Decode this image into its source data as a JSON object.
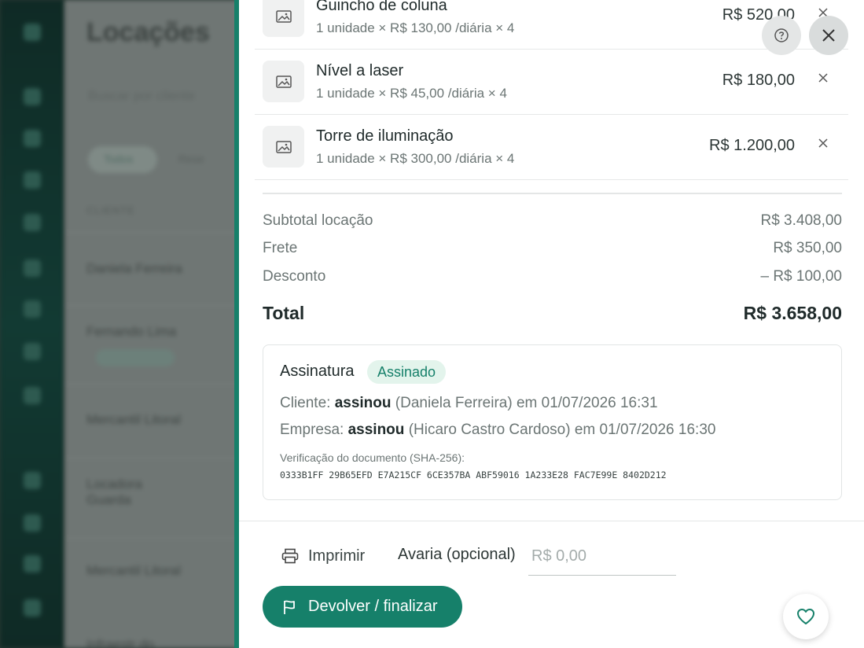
{
  "background": {
    "title": "Locações",
    "search_placeholder": "Buscar por cliente",
    "tabs": [
      "Todos",
      "Rese"
    ],
    "column_header": "CLIENTE",
    "rows": [
      "Daniela Ferreira",
      "Fernando Lima",
      "Mercantil Litoral",
      "Locadora Guarda",
      "Mercantil Litoral",
      "Infraestr do"
    ],
    "row_badge": "Assinado"
  },
  "items": [
    {
      "name": "Guincho de coluna",
      "meta": "1 unidade × R$ 130,00 /diária × 4",
      "price": "R$ 520,00"
    },
    {
      "name": "Nível a laser",
      "meta": "1 unidade × R$ 45,00 /diária × 4",
      "price": "R$ 180,00"
    },
    {
      "name": "Torre de iluminação",
      "meta": "1 unidade × R$ 300,00 /diária × 4",
      "price": "R$ 1.200,00"
    }
  ],
  "summary": {
    "subtotal_label": "Subtotal locação",
    "subtotal_value": "R$ 3.408,00",
    "frete_label": "Frete",
    "frete_value": "R$ 350,00",
    "desconto_label": "Desconto",
    "desconto_value": "– R$ 100,00",
    "total_label": "Total",
    "total_value": "R$ 3.658,00"
  },
  "signature": {
    "title": "Assinatura",
    "status": "Assinado",
    "client_prefix": "Cliente:",
    "client_action": "assinou",
    "client_detail": "(Daniela Ferreira) em 01/07/2026 16:31",
    "company_prefix": "Empresa:",
    "company_action": "assinou",
    "company_detail": "(Hicaro Castro Cardoso) em 01/07/2026 16:30",
    "verify_label": "Verificação do documento (SHA-256):",
    "hash": "0333B1FF 29B65EFD E7A215CF 6CE357BA ABF59016 1A233E28 FAC7E99E 8402D212"
  },
  "footer": {
    "print_label": "Imprimir",
    "avaria_label": "Avaria (opcional)",
    "avaria_placeholder": "R$ 0,00",
    "finish_label": "Devolver / finalizar"
  },
  "colors": {
    "accent": "#16806a",
    "badge_bg": "#e3f4ec"
  }
}
